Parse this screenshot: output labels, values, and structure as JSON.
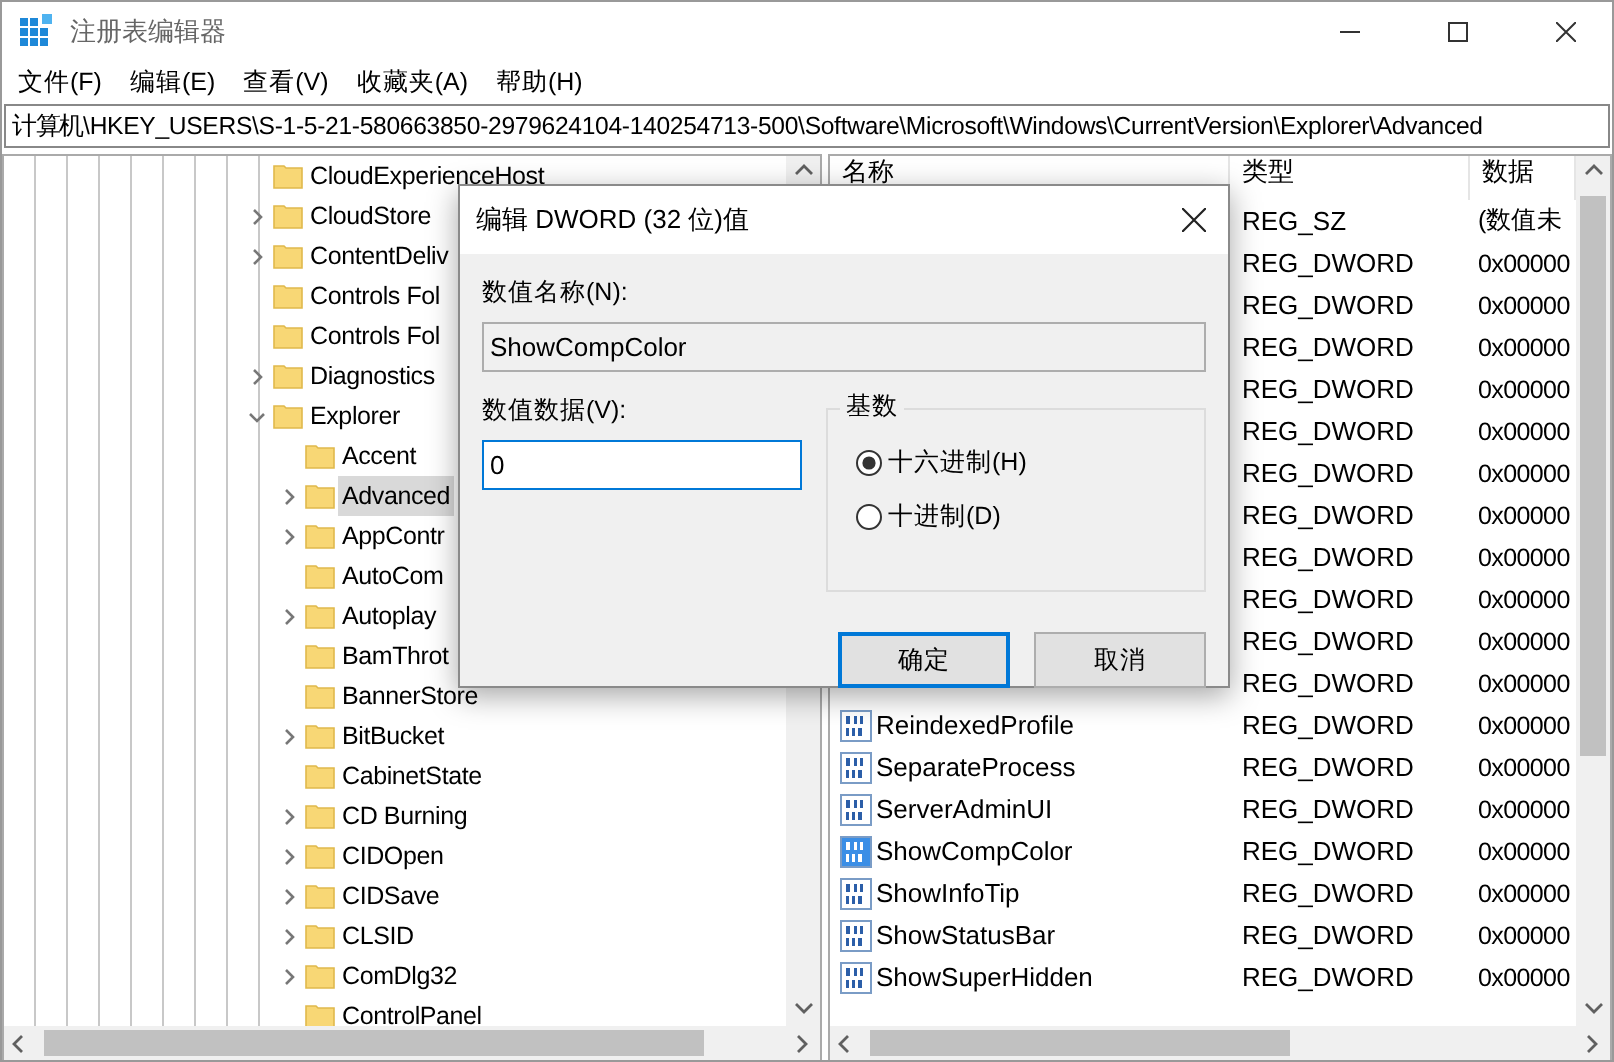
{
  "window": {
    "title": "注册表编辑器"
  },
  "menu": [
    "文件(F)",
    "编辑(E)",
    "查看(V)",
    "收藏夹(A)",
    "帮助(H)"
  ],
  "address": "计算机\\HKEY_USERS\\S-1-5-21-580663850-2979624104-140254713-500\\Software\\Microsoft\\Windows\\CurrentVersion\\Explorer\\Advanced",
  "tree": [
    {
      "label": "CloudExperienceHost",
      "selected": false
    },
    {
      "label": "CloudStore",
      "expanded": false,
      "selected": false
    },
    {
      "label": "ContentDeliv",
      "expanded": false,
      "selected": false
    },
    {
      "label": "Controls Fol",
      "selected": false
    },
    {
      "label": "Controls Fol",
      "selected": false
    },
    {
      "label": "Diagnostics",
      "expanded": false,
      "selected": false
    },
    {
      "label": "Explorer",
      "expanded": true,
      "selected": false,
      "children": [
        {
          "label": "Accent",
          "selected": false
        },
        {
          "label": "Advanced",
          "expanded": false,
          "selected": true
        },
        {
          "label": "AppContr",
          "expanded": false,
          "selected": false
        },
        {
          "label": "AutoCom",
          "selected": false
        },
        {
          "label": "Autoplay",
          "expanded": false,
          "selected": false
        },
        {
          "label": "BamThrot",
          "selected": false
        },
        {
          "label": "BannerStore",
          "selected": false
        },
        {
          "label": "BitBucket",
          "expanded": false,
          "selected": false
        },
        {
          "label": "CabinetState",
          "selected": false
        },
        {
          "label": "CD Burning",
          "expanded": false,
          "selected": false
        },
        {
          "label": "CIDOpen",
          "expanded": false,
          "selected": false
        },
        {
          "label": "CIDSave",
          "expanded": false,
          "selected": false
        },
        {
          "label": "CLSID",
          "expanded": false,
          "selected": false
        },
        {
          "label": "ComDlg32",
          "expanded": false,
          "selected": false
        },
        {
          "label": "ControlPanel",
          "selected": false
        }
      ]
    }
  ],
  "list": {
    "columns": [
      "名称",
      "类型",
      "数据"
    ],
    "rows": [
      {
        "type": "REG_SZ",
        "data": "(数值未"
      },
      {
        "type": "REG_DWORD",
        "data": "0x00000"
      },
      {
        "type": "REG_DWORD",
        "data": "0x00000"
      },
      {
        "type": "REG_DWORD",
        "data": "0x00000"
      },
      {
        "type": "REG_DWORD",
        "data": "0x00000"
      },
      {
        "type": "REG_DWORD",
        "data": "0x00000"
      },
      {
        "type": "REG_DWORD",
        "data": "0x00000"
      },
      {
        "type": "REG_DWORD",
        "data": "0x00000"
      },
      {
        "type": "REG_DWORD",
        "data": "0x00000"
      },
      {
        "type": "REG_DWORD",
        "data": "0x00000"
      },
      {
        "type": "REG_DWORD",
        "data": "0x00000"
      },
      {
        "type": "REG_DWORD",
        "data": "0x00000"
      },
      {
        "name": "ReindexedProfile",
        "type": "REG_DWORD",
        "data": "0x00000",
        "selected": false
      },
      {
        "name": "SeparateProcess",
        "type": "REG_DWORD",
        "data": "0x00000",
        "selected": false
      },
      {
        "name": "ServerAdminUI",
        "type": "REG_DWORD",
        "data": "0x00000",
        "selected": false
      },
      {
        "name": "ShowCompColor",
        "type": "REG_DWORD",
        "data": "0x00000",
        "selected": true
      },
      {
        "name": "ShowInfoTip",
        "type": "REG_DWORD",
        "data": "0x00000",
        "selected": false
      },
      {
        "name": "ShowStatusBar",
        "type": "REG_DWORD",
        "data": "0x00000",
        "selected": false
      },
      {
        "name": "ShowSuperHidden",
        "type": "REG_DWORD",
        "data": "0x00000",
        "selected": false
      }
    ]
  },
  "dialog": {
    "title": "编辑 DWORD (32 位)值",
    "name_label": "数值名称(N):",
    "name_value": "ShowCompColor",
    "data_label": "数值数据(V):",
    "data_value": "0",
    "base_label": "基数",
    "bases": [
      {
        "label": "十六进制(H)",
        "selected": true
      },
      {
        "label": "十进制(D)",
        "selected": false
      }
    ],
    "buttons": [
      {
        "label": "确定",
        "default": true
      },
      {
        "label": "取消",
        "default": false
      }
    ]
  }
}
